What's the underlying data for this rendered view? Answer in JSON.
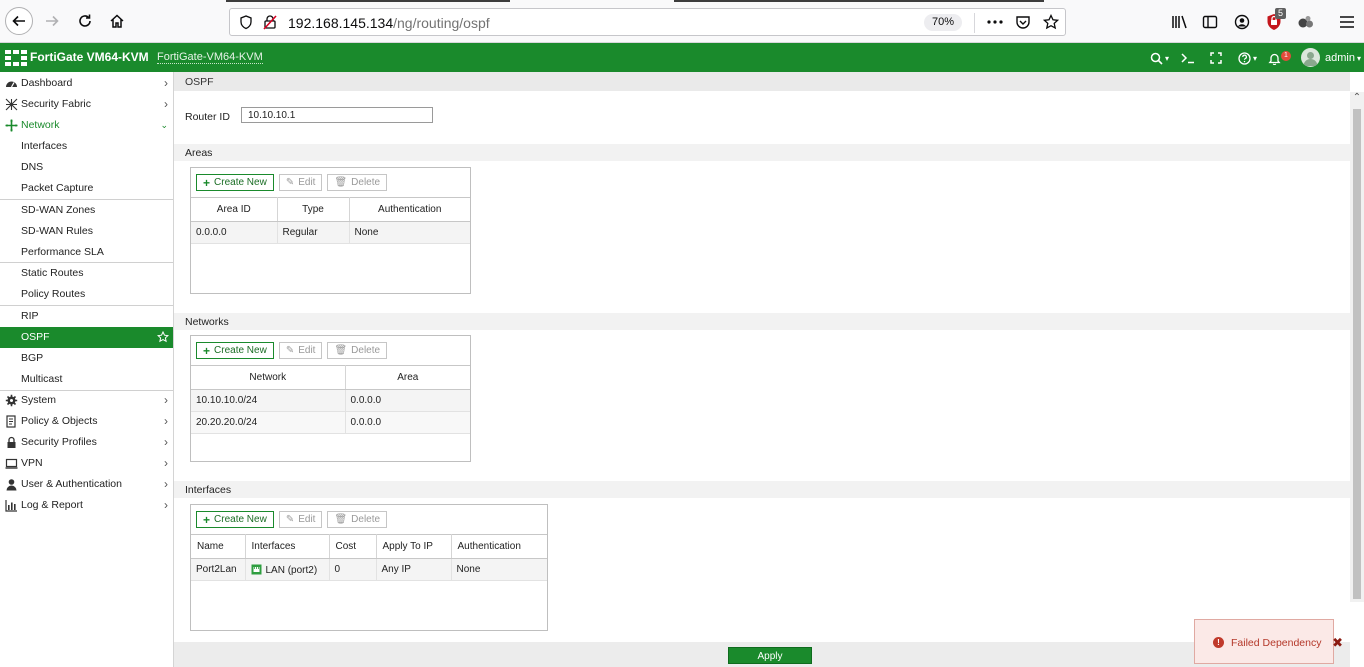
{
  "browser": {
    "url_host": "192.168.145.134",
    "url_path": "/ng/routing/ospf",
    "zoom": "70%",
    "ublock_count": "5"
  },
  "header": {
    "brand": "FortiGate VM64-KVM",
    "hostname": "FortiGate-VM64-KVM",
    "notif_count": "1",
    "user": "admin"
  },
  "sidebar": {
    "items": [
      {
        "label": "Dashboard",
        "icon": "dashboard-icon"
      },
      {
        "label": "Security Fabric",
        "icon": "security-fabric-icon"
      },
      {
        "label": "Network",
        "icon": "network-icon"
      },
      {
        "label": "Interfaces"
      },
      {
        "label": "DNS"
      },
      {
        "label": "Packet Capture"
      },
      {
        "label": "SD-WAN Zones"
      },
      {
        "label": "SD-WAN Rules"
      },
      {
        "label": "Performance SLA"
      },
      {
        "label": "Static Routes"
      },
      {
        "label": "Policy Routes"
      },
      {
        "label": "RIP"
      },
      {
        "label": "OSPF"
      },
      {
        "label": "BGP"
      },
      {
        "label": "Multicast"
      },
      {
        "label": "System",
        "icon": "gear-icon"
      },
      {
        "label": "Policy & Objects",
        "icon": "policy-icon"
      },
      {
        "label": "Security Profiles",
        "icon": "lock-icon"
      },
      {
        "label": "VPN",
        "icon": "vpn-icon"
      },
      {
        "label": "User & Authentication",
        "icon": "user-icon"
      },
      {
        "label": "Log & Report",
        "icon": "chart-icon"
      }
    ]
  },
  "page": {
    "title": "OSPF",
    "router_id_label": "Router ID",
    "router_id_value": "10.10.10.1"
  },
  "toolbar": {
    "create_new": "Create New",
    "edit": "Edit",
    "delete": "Delete"
  },
  "areas": {
    "title": "Areas",
    "columns": [
      "Area ID",
      "Type",
      "Authentication"
    ],
    "rows": [
      [
        "0.0.0.0",
        "Regular",
        "None"
      ]
    ]
  },
  "networks": {
    "title": "Networks",
    "columns": [
      "Network",
      "Area"
    ],
    "rows": [
      [
        "10.10.10.0/24",
        "0.0.0.0"
      ],
      [
        "20.20.20.0/24",
        "0.0.0.0"
      ]
    ]
  },
  "interfaces": {
    "title": "Interfaces",
    "columns": [
      "Name",
      "Interfaces",
      "Cost",
      "Apply To IP",
      "Authentication"
    ],
    "rows": [
      [
        "Port2Lan",
        "LAN (port2)",
        "0",
        "Any IP",
        "None"
      ]
    ]
  },
  "footer": {
    "apply": "Apply"
  },
  "toast": {
    "message": "Failed Dependency"
  },
  "colors": {
    "brand_green": "#1a8a2c",
    "error_red": "#c0392b"
  }
}
